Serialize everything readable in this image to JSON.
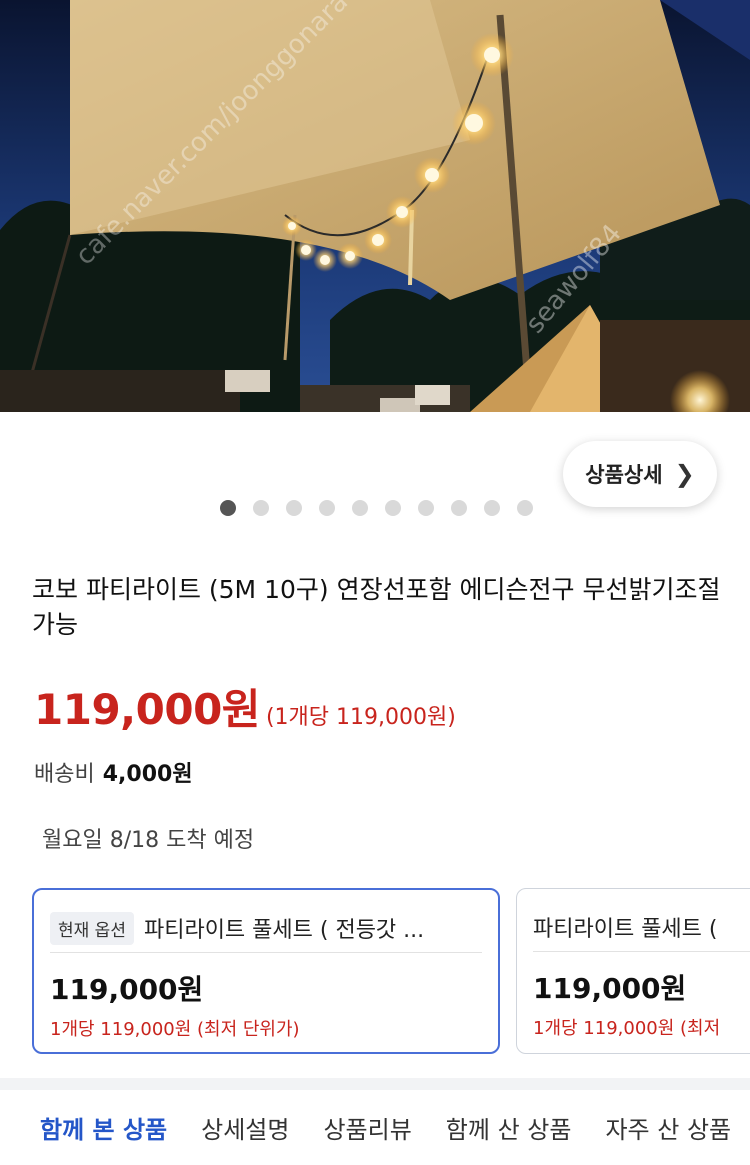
{
  "hero": {
    "watermarks": [
      "cafe.naver.com/joonggonara",
      "seawolf84"
    ]
  },
  "detail_button": {
    "label": "상품상세",
    "icon": "chevron-right-icon"
  },
  "carousel": {
    "total": 10,
    "active_index": 1
  },
  "product": {
    "title": "코보 파티라이트 (5M 10구) 연장선포함 에디슨전구 무선밝기조절가능",
    "price": "119,000원",
    "unit_price": "(1개당 119,000원)",
    "shipping_label": "배송비",
    "shipping_value": "4,000원",
    "arrival": "월요일 8/18 도착 예정"
  },
  "options": [
    {
      "badge": "현재 옵션",
      "name": "파티라이트 풀세트 ( 전등갓 ...",
      "price": "119,000원",
      "unit": "1개당 119,000원 (최저 단위가)"
    },
    {
      "badge": "",
      "name": "파티라이트 풀세트 (",
      "price": "119,000원",
      "unit": "1개당 119,000원 (최저"
    }
  ],
  "tabs": [
    {
      "label": "함께 본 상품",
      "active": true
    },
    {
      "label": "상세설명",
      "active": false
    },
    {
      "label": "상품리뷰",
      "active": false
    },
    {
      "label": "함께 산 상품",
      "active": false
    },
    {
      "label": "자주 산 상품",
      "active": false
    }
  ],
  "colors": {
    "price_red": "#c8241d",
    "accent_blue": "#2456c8",
    "card_border": "#4a6fd8"
  }
}
